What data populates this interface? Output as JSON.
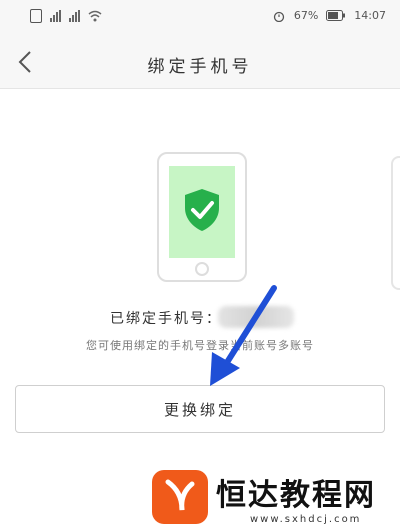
{
  "status_bar": {
    "battery_percent": "67%",
    "time": "14:07"
  },
  "header": {
    "title": "绑定手机号"
  },
  "main": {
    "bound_label": "已绑定手机号：",
    "hint": "您可使用绑定的手机号登录当前账号多账号",
    "change_button_label": "更换绑定"
  },
  "watermark": {
    "brand": "恒达教程网",
    "url": "www.sxhdcj.com"
  },
  "colors": {
    "accent_green": "#27b04b",
    "phone_screen": "#c7f5c5",
    "arrow_blue": "#1f4fd6",
    "logo_orange": "#f05a1a"
  },
  "icons": [
    "sim-icon",
    "signal-icon",
    "wifi-icon",
    "alarm-icon",
    "battery-icon",
    "back-icon",
    "shield-check-icon",
    "arrow-icon"
  ]
}
